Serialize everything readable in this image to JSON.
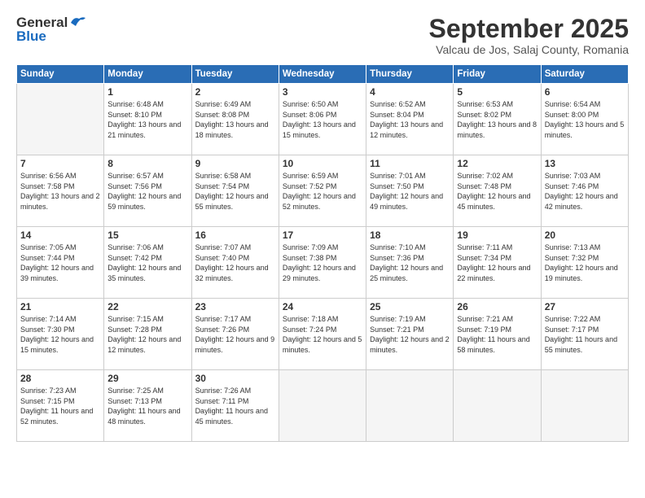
{
  "header": {
    "logo_general": "General",
    "logo_blue": "Blue",
    "month_title": "September 2025",
    "location": "Valcau de Jos, Salaj County, Romania"
  },
  "weekdays": [
    "Sunday",
    "Monday",
    "Tuesday",
    "Wednesday",
    "Thursday",
    "Friday",
    "Saturday"
  ],
  "weeks": [
    [
      {
        "day": "",
        "empty": true
      },
      {
        "day": "1",
        "sunrise": "Sunrise: 6:48 AM",
        "sunset": "Sunset: 8:10 PM",
        "daylight": "Daylight: 13 hours and 21 minutes."
      },
      {
        "day": "2",
        "sunrise": "Sunrise: 6:49 AM",
        "sunset": "Sunset: 8:08 PM",
        "daylight": "Daylight: 13 hours and 18 minutes."
      },
      {
        "day": "3",
        "sunrise": "Sunrise: 6:50 AM",
        "sunset": "Sunset: 8:06 PM",
        "daylight": "Daylight: 13 hours and 15 minutes."
      },
      {
        "day": "4",
        "sunrise": "Sunrise: 6:52 AM",
        "sunset": "Sunset: 8:04 PM",
        "daylight": "Daylight: 13 hours and 12 minutes."
      },
      {
        "day": "5",
        "sunrise": "Sunrise: 6:53 AM",
        "sunset": "Sunset: 8:02 PM",
        "daylight": "Daylight: 13 hours and 8 minutes."
      },
      {
        "day": "6",
        "sunrise": "Sunrise: 6:54 AM",
        "sunset": "Sunset: 8:00 PM",
        "daylight": "Daylight: 13 hours and 5 minutes."
      }
    ],
    [
      {
        "day": "7",
        "sunrise": "Sunrise: 6:56 AM",
        "sunset": "Sunset: 7:58 PM",
        "daylight": "Daylight: 13 hours and 2 minutes."
      },
      {
        "day": "8",
        "sunrise": "Sunrise: 6:57 AM",
        "sunset": "Sunset: 7:56 PM",
        "daylight": "Daylight: 12 hours and 59 minutes."
      },
      {
        "day": "9",
        "sunrise": "Sunrise: 6:58 AM",
        "sunset": "Sunset: 7:54 PM",
        "daylight": "Daylight: 12 hours and 55 minutes."
      },
      {
        "day": "10",
        "sunrise": "Sunrise: 6:59 AM",
        "sunset": "Sunset: 7:52 PM",
        "daylight": "Daylight: 12 hours and 52 minutes."
      },
      {
        "day": "11",
        "sunrise": "Sunrise: 7:01 AM",
        "sunset": "Sunset: 7:50 PM",
        "daylight": "Daylight: 12 hours and 49 minutes."
      },
      {
        "day": "12",
        "sunrise": "Sunrise: 7:02 AM",
        "sunset": "Sunset: 7:48 PM",
        "daylight": "Daylight: 12 hours and 45 minutes."
      },
      {
        "day": "13",
        "sunrise": "Sunrise: 7:03 AM",
        "sunset": "Sunset: 7:46 PM",
        "daylight": "Daylight: 12 hours and 42 minutes."
      }
    ],
    [
      {
        "day": "14",
        "sunrise": "Sunrise: 7:05 AM",
        "sunset": "Sunset: 7:44 PM",
        "daylight": "Daylight: 12 hours and 39 minutes."
      },
      {
        "day": "15",
        "sunrise": "Sunrise: 7:06 AM",
        "sunset": "Sunset: 7:42 PM",
        "daylight": "Daylight: 12 hours and 35 minutes."
      },
      {
        "day": "16",
        "sunrise": "Sunrise: 7:07 AM",
        "sunset": "Sunset: 7:40 PM",
        "daylight": "Daylight: 12 hours and 32 minutes."
      },
      {
        "day": "17",
        "sunrise": "Sunrise: 7:09 AM",
        "sunset": "Sunset: 7:38 PM",
        "daylight": "Daylight: 12 hours and 29 minutes."
      },
      {
        "day": "18",
        "sunrise": "Sunrise: 7:10 AM",
        "sunset": "Sunset: 7:36 PM",
        "daylight": "Daylight: 12 hours and 25 minutes."
      },
      {
        "day": "19",
        "sunrise": "Sunrise: 7:11 AM",
        "sunset": "Sunset: 7:34 PM",
        "daylight": "Daylight: 12 hours and 22 minutes."
      },
      {
        "day": "20",
        "sunrise": "Sunrise: 7:13 AM",
        "sunset": "Sunset: 7:32 PM",
        "daylight": "Daylight: 12 hours and 19 minutes."
      }
    ],
    [
      {
        "day": "21",
        "sunrise": "Sunrise: 7:14 AM",
        "sunset": "Sunset: 7:30 PM",
        "daylight": "Daylight: 12 hours and 15 minutes."
      },
      {
        "day": "22",
        "sunrise": "Sunrise: 7:15 AM",
        "sunset": "Sunset: 7:28 PM",
        "daylight": "Daylight: 12 hours and 12 minutes."
      },
      {
        "day": "23",
        "sunrise": "Sunrise: 7:17 AM",
        "sunset": "Sunset: 7:26 PM",
        "daylight": "Daylight: 12 hours and 9 minutes."
      },
      {
        "day": "24",
        "sunrise": "Sunrise: 7:18 AM",
        "sunset": "Sunset: 7:24 PM",
        "daylight": "Daylight: 12 hours and 5 minutes."
      },
      {
        "day": "25",
        "sunrise": "Sunrise: 7:19 AM",
        "sunset": "Sunset: 7:21 PM",
        "daylight": "Daylight: 12 hours and 2 minutes."
      },
      {
        "day": "26",
        "sunrise": "Sunrise: 7:21 AM",
        "sunset": "Sunset: 7:19 PM",
        "daylight": "Daylight: 11 hours and 58 minutes."
      },
      {
        "day": "27",
        "sunrise": "Sunrise: 7:22 AM",
        "sunset": "Sunset: 7:17 PM",
        "daylight": "Daylight: 11 hours and 55 minutes."
      }
    ],
    [
      {
        "day": "28",
        "sunrise": "Sunrise: 7:23 AM",
        "sunset": "Sunset: 7:15 PM",
        "daylight": "Daylight: 11 hours and 52 minutes."
      },
      {
        "day": "29",
        "sunrise": "Sunrise: 7:25 AM",
        "sunset": "Sunset: 7:13 PM",
        "daylight": "Daylight: 11 hours and 48 minutes."
      },
      {
        "day": "30",
        "sunrise": "Sunrise: 7:26 AM",
        "sunset": "Sunset: 7:11 PM",
        "daylight": "Daylight: 11 hours and 45 minutes."
      },
      {
        "day": "",
        "empty": true
      },
      {
        "day": "",
        "empty": true
      },
      {
        "day": "",
        "empty": true
      },
      {
        "day": "",
        "empty": true
      }
    ]
  ]
}
